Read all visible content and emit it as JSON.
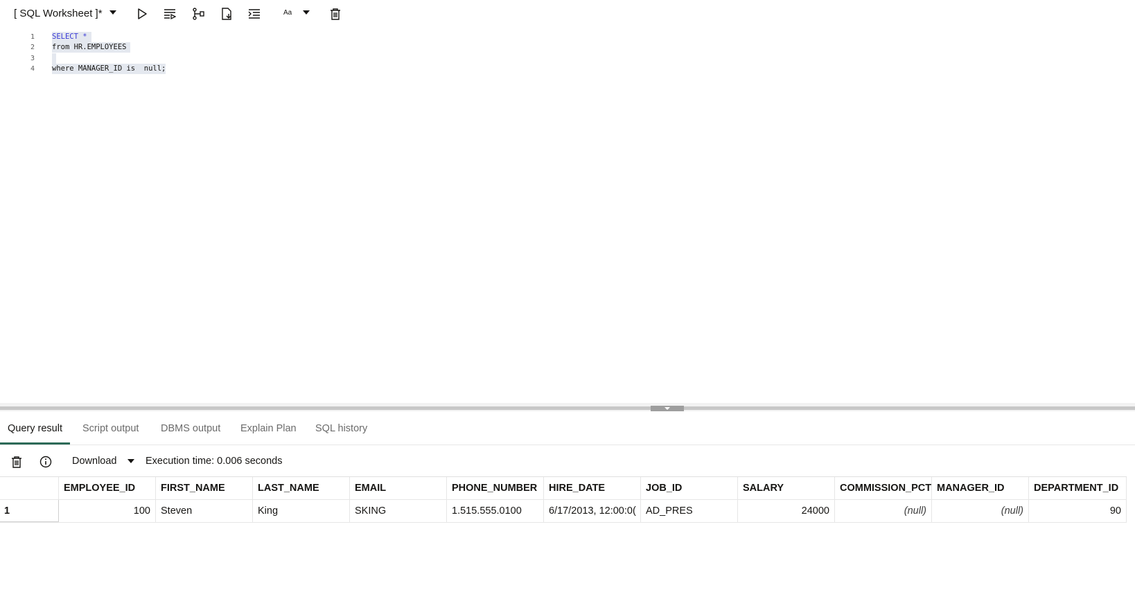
{
  "toolbar": {
    "worksheet_title": "[ SQL Worksheet ]*",
    "font_size_label": "Aa"
  },
  "editor": {
    "lines": [
      {
        "num": "1",
        "text": "SELECT *"
      },
      {
        "num": "2",
        "text": "from HR.EMPLOYEES"
      },
      {
        "num": "3",
        "text": ""
      },
      {
        "num": "4",
        "text": "where MANAGER_ID is  null;"
      }
    ]
  },
  "tabs": [
    {
      "label": "Query result"
    },
    {
      "label": "Script output"
    },
    {
      "label": "DBMS output"
    },
    {
      "label": "Explain Plan"
    },
    {
      "label": "SQL history"
    }
  ],
  "results": {
    "download_label": "Download",
    "execution_time": "Execution time: 0.006 seconds",
    "columns": [
      "EMPLOYEE_ID",
      "FIRST_NAME",
      "LAST_NAME",
      "EMAIL",
      "PHONE_NUMBER",
      "HIRE_DATE",
      "JOB_ID",
      "SALARY",
      "COMMISSION_PCT",
      "MANAGER_ID",
      "DEPARTMENT_ID"
    ],
    "rows": [
      {
        "row_num": "1",
        "cells": [
          "100",
          "Steven",
          "King",
          "SKING",
          "1.515.555.0100",
          "6/17/2013, 12:00:0(",
          "AD_PRES",
          "24000",
          "(null)",
          "(null)",
          "90"
        ]
      }
    ]
  }
}
